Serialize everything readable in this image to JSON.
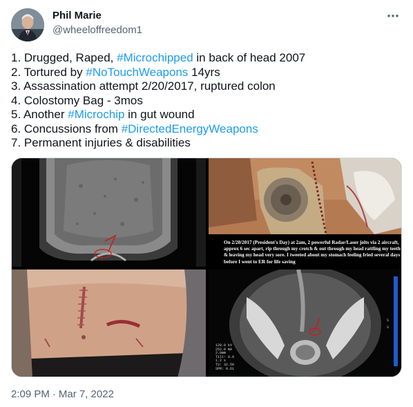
{
  "author": {
    "name": "Phil Marie",
    "handle": "@wheeloffreedom1",
    "avatar_icon": "profile-photo"
  },
  "more_icon": "more-horizontal-icon",
  "tweet": {
    "lines": [
      {
        "pre": "1. Drugged, Raped, ",
        "tag": "#Microchipped",
        "post": " in back of head 2007"
      },
      {
        "pre": "2. Tortured by ",
        "tag": "#NoTouchWeapons",
        "post": " 14yrs"
      },
      {
        "pre": "3. Assassination attempt 2/20/2017, ruptured colon",
        "tag": "",
        "post": ""
      },
      {
        "pre": "4. Colostomy Bag - 3mos",
        "tag": "",
        "post": ""
      },
      {
        "pre": "5. Another ",
        "tag": "#Microchip",
        "post": " in gut wound"
      },
      {
        "pre": "6. Concussions from ",
        "tag": "#DirectedEnergyWeapons",
        "post": ""
      },
      {
        "pre": "7. Permanent injuries & disabilities",
        "tag": "",
        "post": ""
      }
    ]
  },
  "media": {
    "overlay_text": "On 2/20/2017 (President's Day) at 2am, 2 powerful Radar/Laser jolts via 2 aircraft, approx 6 sec apart, rip through my crotch & out through my head rattling my teeth & leaving my head very sore. I tweeted about my stomach feeling fried several days before I went to ER for life saving",
    "scan_info": "120.0 kV\n252.0 mA\n2.0mm\nTilt: 0.0\n1.2 s\nTS: 32.50\nSPR: 0.61"
  },
  "timestamp": {
    "time": "2:09 PM",
    "separator": "·",
    "date": "Mar 7, 2022"
  },
  "colors": {
    "link": "#1d9bf0",
    "secondary": "#536471",
    "border": "#cfd9de"
  }
}
